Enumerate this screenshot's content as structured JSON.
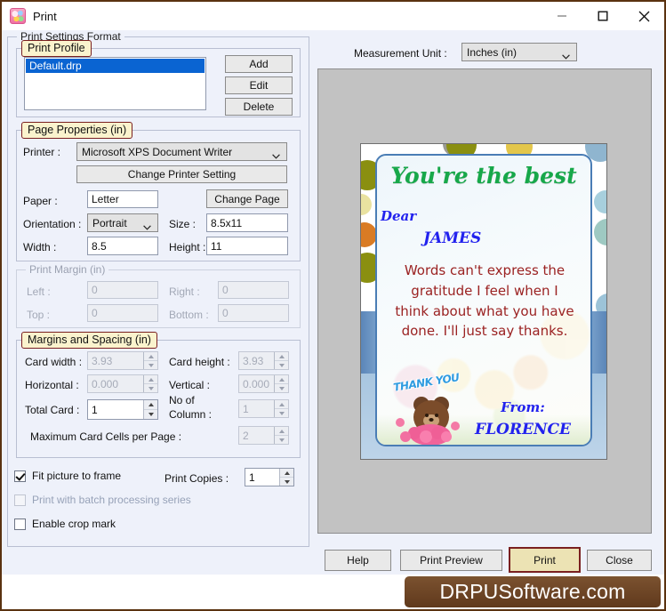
{
  "window": {
    "title": "Print",
    "icon": "app-icon",
    "minimize": "minimize-icon",
    "maximize": "maximize-icon",
    "close": "close-icon"
  },
  "settings_group": {
    "caption": "Print Settings Format"
  },
  "print_profile": {
    "caption": "Print Profile",
    "items": [
      "Default.drp"
    ],
    "selected": "Default.drp",
    "buttons": {
      "add": "Add",
      "edit": "Edit",
      "delete": "Delete"
    }
  },
  "page_properties": {
    "caption": "Page Properties  (in)",
    "printer_label": "Printer :",
    "printer_value": "Microsoft XPS Document Writer",
    "change_printer_setting": "Change Printer Setting",
    "paper_label": "Paper :",
    "paper_value": "Letter",
    "change_page": "Change Page",
    "orientation_label": "Orientation :",
    "orientation_value": "Portrait",
    "size_label": "Size :",
    "size_value": "8.5x11",
    "width_label": "Width :",
    "width_value": "8.5",
    "height_label": "Height :",
    "height_value": "11"
  },
  "print_margin": {
    "caption": "Print Margin (in)",
    "left_label": "Left :",
    "left_value": "0",
    "right_label": "Right :",
    "right_value": "0",
    "top_label": "Top :",
    "top_value": "0",
    "bottom_label": "Bottom :",
    "bottom_value": "0"
  },
  "margins_spacing": {
    "caption": "Margins and Spacing  (in)",
    "card_width_label": "Card width :",
    "card_width_value": "3.93",
    "card_height_label": "Card height :",
    "card_height_value": "3.93",
    "horizontal_label": "Horizontal :",
    "horizontal_value": "0.000",
    "vertical_label": "Vertical :",
    "vertical_value": "0.000",
    "total_card_label": "Total Card :",
    "total_card_value": "1",
    "no_of_column_label": "No of\nColumn :",
    "no_of_column_line1": "No of",
    "no_of_column_line2": "Column :",
    "no_of_column_value": "1",
    "max_cells_label": "Maximum Card Cells per Page :",
    "max_cells_value": "2"
  },
  "options": {
    "fit_picture": {
      "label": "Fit picture to frame",
      "checked": true,
      "enabled": true
    },
    "batch": {
      "label": "Print with batch processing series",
      "checked": false,
      "enabled": false
    },
    "crop_mark": {
      "label": "Enable crop mark",
      "checked": false,
      "enabled": true
    },
    "print_copies_label": "Print Copies :",
    "print_copies_value": "1"
  },
  "measurement": {
    "label": "Measurement Unit :",
    "value": "Inches (in)"
  },
  "card_preview": {
    "title": "You're the best",
    "salutation": "Dear",
    "recipient": "JAMES",
    "body": "Words can't express the gratitude I feel when I think about what you have done. I'll just say thanks.",
    "from_label": "From:",
    "sender": "FLORENCE",
    "sticker_text": "THANK YOU",
    "colors": {
      "title": "#17a84a",
      "name": "#2222ee",
      "body": "#9b2222",
      "border": "#4a7db5"
    }
  },
  "footer": {
    "help": "Help",
    "print_preview": "Print Preview",
    "print": "Print",
    "close": "Close",
    "brand": "DRPUSoftware.com",
    "accent_color": "#ece3b4",
    "brand_color": "#60391c"
  }
}
